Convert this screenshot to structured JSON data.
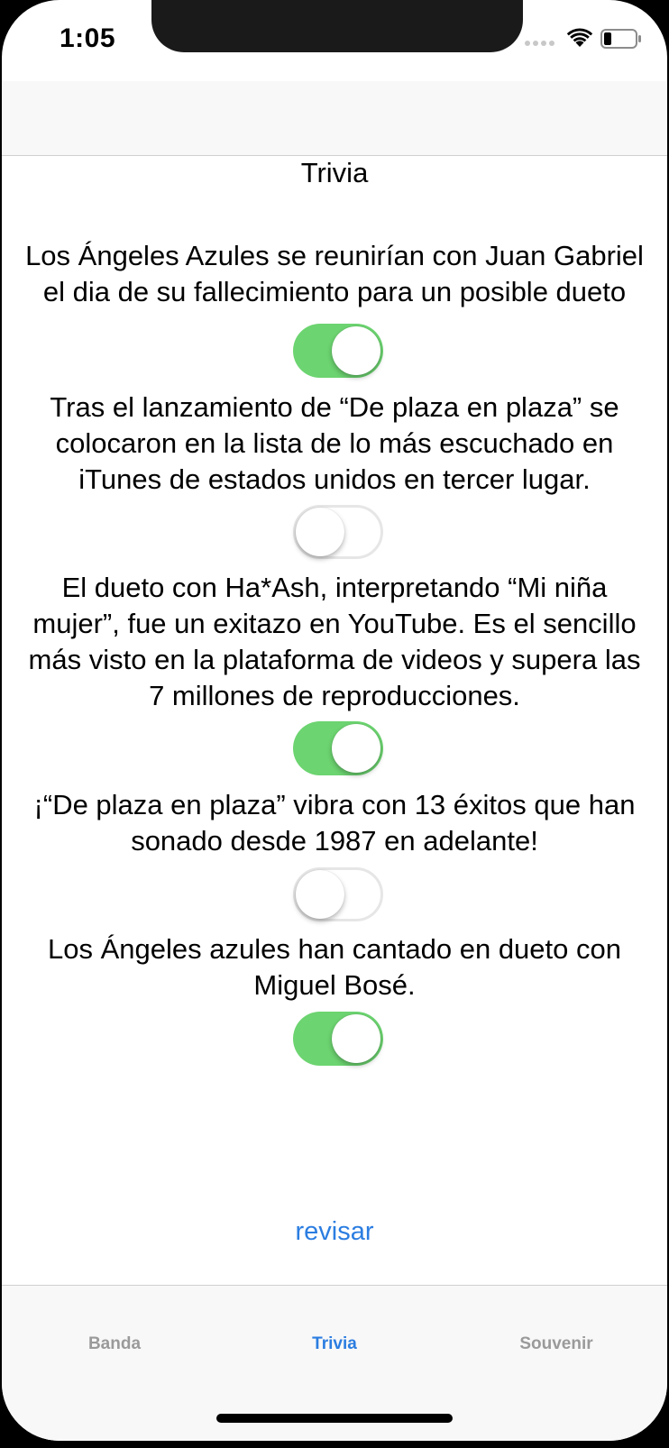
{
  "status_bar": {
    "time": "1:05",
    "icons": [
      "cellular-signal-icon",
      "wifi-icon",
      "battery-icon"
    ]
  },
  "page": {
    "title": "Trivia"
  },
  "questions": [
    {
      "lines": [
        "Los Ángeles Azules se reunirían con Juan Gabriel",
        "el dia de su fallecimiento para un posible dueto"
      ],
      "toggle_on": true
    },
    {
      "lines": [
        "Tras el lanzamiento de “De plaza en plaza” se",
        "colocaron en la lista de lo más escuchado en",
        "iTunes de estados unidos en tercer lugar."
      ],
      "toggle_on": false
    },
    {
      "lines": [
        "El dueto con Ha*Ash, interpretando “Mi niña",
        "mujer”, fue un exitazo en YouTube. Es el sencillo",
        "más visto en la plataforma de videos y supera las",
        "7 millones de reproducciones."
      ],
      "toggle_on": true
    },
    {
      "lines": [
        "¡“De plaza en plaza” vibra con 13 éxitos que han",
        "sonado desde 1987 en adelante!"
      ],
      "toggle_on": false
    },
    {
      "lines": [
        "Los Ángeles azules han cantado en dueto con",
        "Miguel Bosé."
      ],
      "toggle_on": true
    }
  ],
  "actions": {
    "check_label": "revisar"
  },
  "tab_bar": {
    "tabs": [
      {
        "label": "Banda",
        "active": false
      },
      {
        "label": "Trivia",
        "active": true
      },
      {
        "label": "Souvenir",
        "active": false
      }
    ]
  },
  "colors": {
    "toggle_on": "#6cd470",
    "accent": "#2b7de1",
    "tab_inactive": "#9a9a9a"
  }
}
